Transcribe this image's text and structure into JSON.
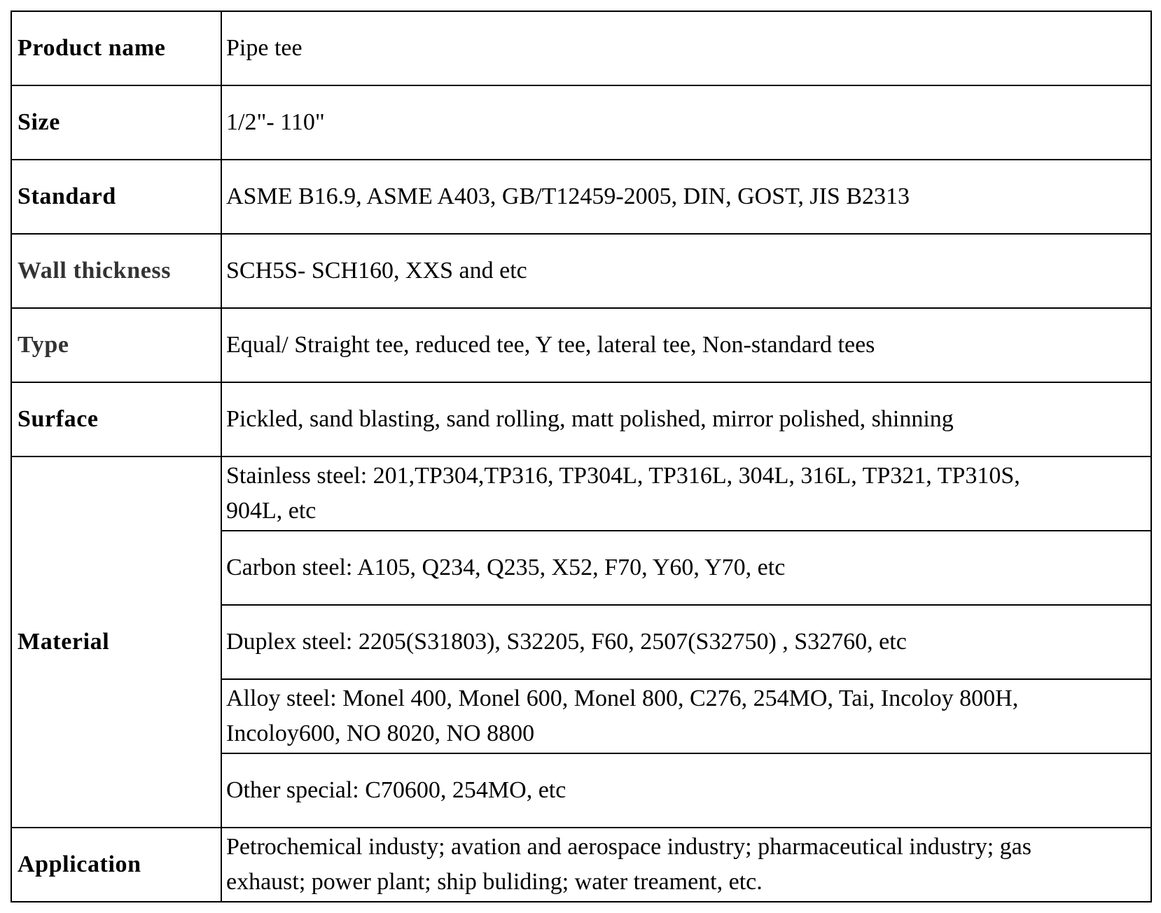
{
  "table": {
    "rows": [
      {
        "label": "Product name",
        "value": "Pipe tee"
      },
      {
        "label": "Size",
        "value": "1/2\"- 110\""
      },
      {
        "label": "Standard",
        "value": "ASME B16.9, ASME A403, GB/T12459-2005, DIN, GOST, JIS B2313"
      },
      {
        "label": "Wall thickness",
        "value": "SCH5S- SCH160, XXS and etc"
      },
      {
        "label": "Type",
        "value": "Equal/ Straight tee, reduced tee, Y tee, lateral tee, Non-standard tees"
      },
      {
        "label": "Surface",
        "value": "Pickled, sand blasting, sand rolling, matt polished, mirror polished, shinning"
      }
    ],
    "material": {
      "label": "Material",
      "entries": [
        {
          "lines": [
            "Stainless steel: 201,TP304,TP316, TP304L, TP316L, 304L, 316L, TP321, TP310S,",
            "904L, etc"
          ]
        },
        {
          "lines": [
            "Carbon steel: A105, Q234, Q235, X52, F70, Y60, Y70, etc"
          ]
        },
        {
          "lines": [
            "Duplex steel: 2205(S31803), S32205, F60, 2507(S32750) , S32760, etc"
          ]
        },
        {
          "lines": [
            "Alloy steel: Monel 400, Monel 600, Monel 800, C276, 254MO, Tai, Incoloy 800H,",
            "Incoloy600, NO 8020, NO 8800"
          ]
        },
        {
          "lines": [
            "Other special: C70600, 254MO, etc"
          ]
        }
      ]
    },
    "application": {
      "label": "Application",
      "lines": [
        "Petrochemical industy; avation and aerospace industry; pharmaceutical industry; gas",
        "exhaust;  power plant; ship buliding; water treament, etc."
      ]
    }
  }
}
